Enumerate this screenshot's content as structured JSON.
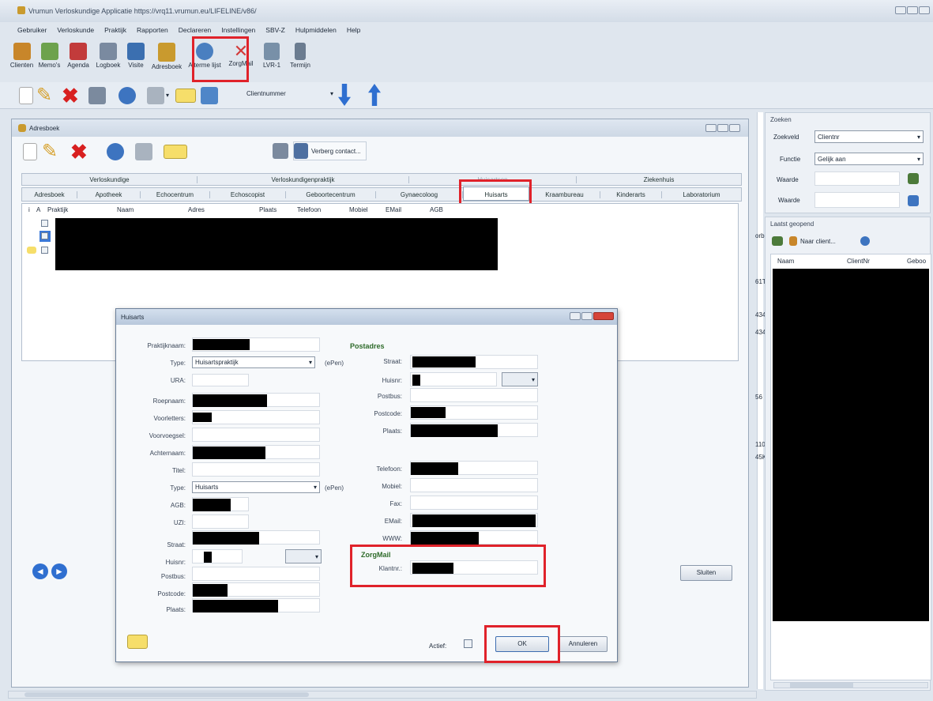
{
  "title_bar": "Vrumun Verloskundige Applicatie https://vrq11.vrumun.eu/LIFELINE/v86/",
  "menu": [
    "Gebruiker",
    "Verloskunde",
    "Praktijk",
    "Rapporten",
    "Declareren",
    "Instellingen",
    "SBV-Z",
    "Hulpmiddelen",
    "Help"
  ],
  "toolbar": [
    {
      "label": "Clienten",
      "icon": "clients-icon",
      "color": "#c8862a"
    },
    {
      "label": "Memo's",
      "icon": "memo-icon",
      "color": "#6da24d"
    },
    {
      "label": "Agenda",
      "icon": "agenda-icon",
      "color": "#c23b3b"
    },
    {
      "label": "Logboek",
      "icon": "logbook-icon",
      "color": "#7a8aa0"
    },
    {
      "label": "Visite",
      "icon": "visit-icon",
      "color": "#3b6fb0"
    },
    {
      "label": "Adresboek",
      "icon": "addressbook-icon",
      "color": "#c99a2e"
    },
    {
      "label": "A terme lijst",
      "icon": "alarm-clock-icon",
      "color": "#4a7fc0"
    },
    {
      "label": "ZorgMail",
      "icon": "zorgmail-icon",
      "color": "#d23a3a"
    },
    {
      "label": "LVR-1",
      "icon": "lvr-icon",
      "color": "#7890a8"
    },
    {
      "label": "Termijn",
      "icon": "termijn-icon",
      "color": "#6b7c90"
    }
  ],
  "toolbar2": {
    "combo": "Clientnummer"
  },
  "adresboek": {
    "title": "Adresboek",
    "hide_contact": "Verberg contact...",
    "tabs_row1": [
      "Verloskundige",
      "Verloskundigenpraktijk",
      "Huisartsen",
      "Ziekenhuis"
    ],
    "tabs_row2": [
      "Adresboek",
      "Apotheek",
      "Echocentrum",
      "Echoscopist",
      "Geboortecentrum",
      "Gynaecoloog",
      "Huisarts",
      "Kraambureau",
      "Kinderarts",
      "Laboratorium"
    ],
    "columns": [
      "i",
      "A",
      "Praktijk",
      "Naam",
      "Adres",
      "Plaats",
      "Telefoon",
      "Mobiel",
      "EMail",
      "AGB"
    ],
    "close": "Sluiten"
  },
  "dialog": {
    "title": "Huisarts",
    "left": {
      "praktijknaam": "Praktijknaam:",
      "type": "Type:",
      "type_value": "Huisartspraktijk",
      "epref": "(ePen)",
      "ura": "URA:",
      "roepnaam": "Roepnaam:",
      "voorletters": "Voorletters:",
      "voorvoegsel": "Voorvoegsel:",
      "achternaam": "Achternaam:",
      "titel": "Titel:",
      "type2": "Type:",
      "type2_value": "Huisarts",
      "agb": "AGB:",
      "uzi": "UZI:",
      "straat": "Straat:",
      "huisnr": "Huisnr:",
      "postbus": "Postbus:",
      "postcode": "Postcode:",
      "plaats": "Plaats:"
    },
    "right": {
      "postadres": "Postadres",
      "straat": "Straat:",
      "huisnr": "Huisnr:",
      "postbus": "Postbus:",
      "postcode": "Postcode:",
      "plaats": "Plaats:",
      "telefoon": "Telefoon:",
      "mobiel": "Mobiel:",
      "fax": "Fax:",
      "email": "EMail:",
      "www": "WWW:",
      "zorgmail": "ZorgMail",
      "klantnr": "Klantnr.:"
    },
    "actief": "Actief:",
    "ok": "OK",
    "annuleren": "Annuleren"
  },
  "zoeken": {
    "title": "Zoeken",
    "zoekveld": "Zoekveld",
    "zoekveld_value": "Clientnr",
    "functie": "Functie",
    "functie_value": "Gelijk aan",
    "waarde": "Waarde",
    "waarde2": "Waarde"
  },
  "laatst": {
    "title": "Laatst geopend",
    "naar_client": "Naar client...",
    "columns": [
      "Naam",
      "ClientNr",
      "Geboo"
    ]
  },
  "background_fragments": [
    "orb",
    "61T",
    "434",
    "434",
    "56",
    "110",
    "45K"
  ]
}
